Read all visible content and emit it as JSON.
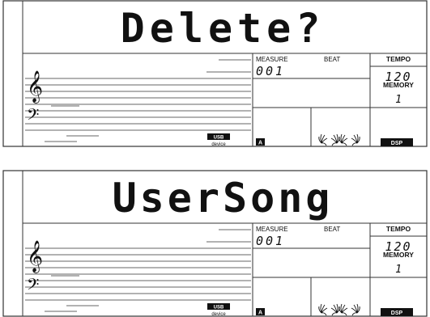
{
  "displays": [
    {
      "message": "Delete?",
      "measure_label": "MEASURE",
      "measure_value": "001",
      "beat_label": "BEAT",
      "tempo_label": "TEMPO",
      "tempo_value": "120",
      "memory_label": "MEMORY",
      "memory_value": "1",
      "usb_label": "USB",
      "device_label": "device",
      "track_label": "A",
      "dsp_label": "DSP"
    },
    {
      "message": "UserSong",
      "measure_label": "MEASURE",
      "measure_value": "001",
      "beat_label": "BEAT",
      "tempo_label": "TEMPO",
      "tempo_value": "120",
      "memory_label": "MEMORY",
      "memory_value": "1",
      "usb_label": "USB",
      "device_label": "device",
      "track_label": "A",
      "dsp_label": "DSP"
    }
  ]
}
